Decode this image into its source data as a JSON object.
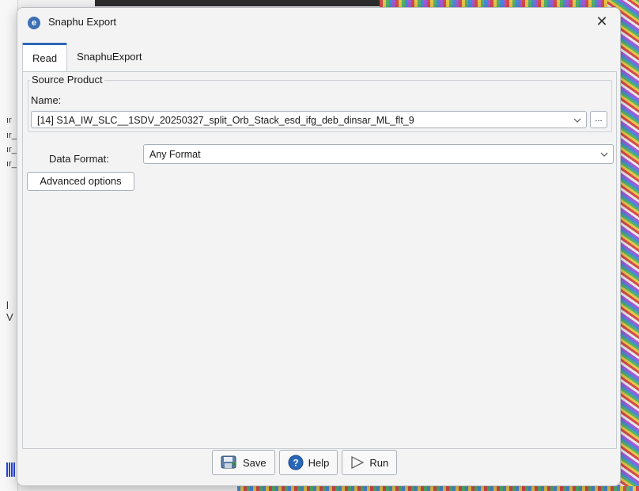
{
  "dialog": {
    "title": "Snaphu Export",
    "close_glyph": "✕"
  },
  "tabs": [
    {
      "label": "Read",
      "active": true
    },
    {
      "label": "SnaphuExport",
      "active": false
    }
  ],
  "source_product": {
    "group_title": "Source Product",
    "name_label": "Name:",
    "selected": "[14] S1A_IW_SLC__1SDV_20250327_split_Orb_Stack_esd_ifg_deb_dinsar_ML_flt_9",
    "browse_label": "..."
  },
  "data_format": {
    "label": "Data Format:",
    "selected": "Any Format"
  },
  "advanced_options_label": "Advanced options",
  "buttons": {
    "save": "Save",
    "help": "Help",
    "run": "Run"
  },
  "icons": {
    "app": "snap-app-icon",
    "save": "save-icon",
    "help": "help-icon",
    "run": "run-icon",
    "close": "close-icon",
    "chevron": "chevron-down-icon"
  },
  "colors": {
    "accent": "#2a66b8",
    "dialog_bg": "#f3f3f3"
  },
  "background_app": {
    "left_snippets": [
      "ır",
      "ır_",
      "ır_",
      "ır_",
      "l V"
    ]
  }
}
